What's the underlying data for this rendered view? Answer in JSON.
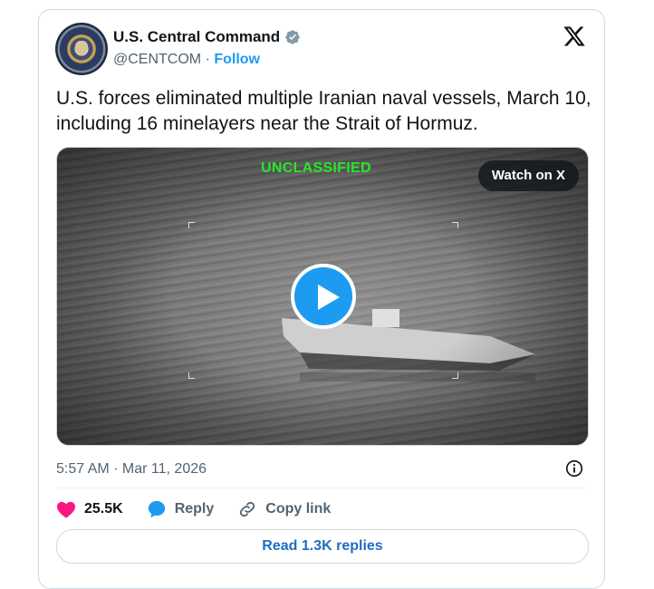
{
  "account": {
    "display_name": "U.S. Central Command",
    "handle": "@CENTCOM",
    "separator": " · ",
    "follow_label": "Follow",
    "verified_color": "#829aab"
  },
  "tweet": {
    "text": "U.S. forces eliminated multiple Iranian naval vessels, March 10, including 16 minelayers near the Strait of Hormuz."
  },
  "media": {
    "overlay_text": "UNCLASSIFIED",
    "watch_label": "Watch on X",
    "play_icon": "play-icon"
  },
  "meta": {
    "timestamp": "5:57 AM · Mar 11, 2026"
  },
  "actions": {
    "like_count": "25.5K",
    "reply_label": "Reply",
    "copy_label": "Copy link"
  },
  "replies": {
    "label": "Read 1.3K replies"
  },
  "colors": {
    "accent": "#1d9bf0",
    "like": "#f91880",
    "overlay_green": "#27e627"
  }
}
